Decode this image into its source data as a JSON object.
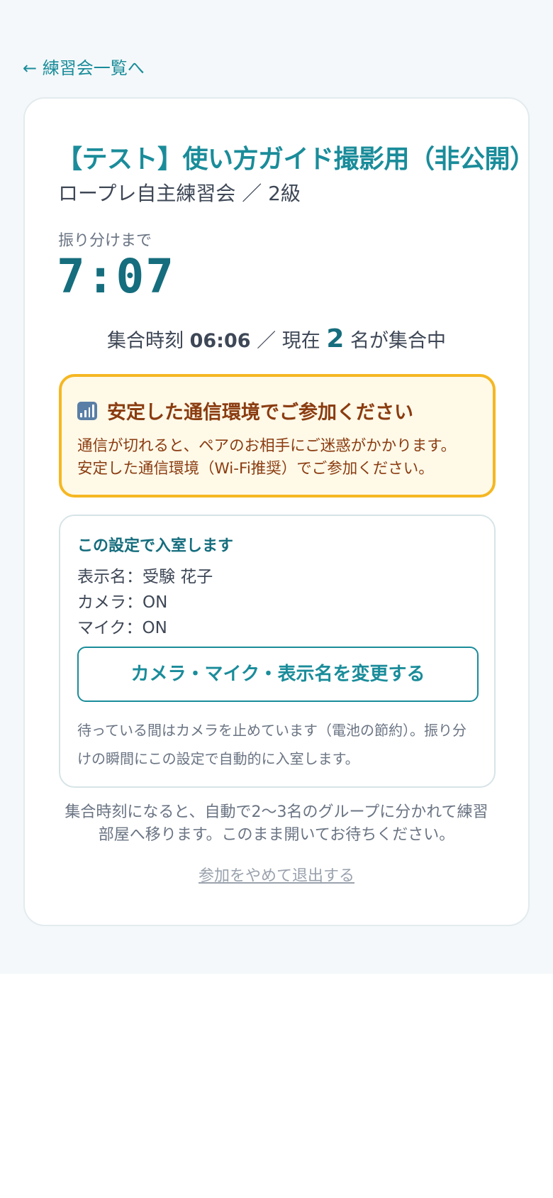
{
  "nav": {
    "back_label": "← 練習会一覧へ"
  },
  "event": {
    "title": "【テスト】使い方ガイド撮影用（非公開）",
    "subtitle": "ロープレ自主練習会 ／ 2級"
  },
  "countdown": {
    "label": "振り分けまで",
    "value": "7:07"
  },
  "gathering": {
    "prefix": "集合時刻 ",
    "time": "06:06",
    "middle": " ／ 現在 ",
    "count": "2",
    "suffix": " 名が集合中"
  },
  "warning": {
    "icon": "signal-strength-icon",
    "title": "安定した通信環境でご参加ください",
    "line1": "通信が切れると、ペアのお相手にご迷惑がかかります。",
    "line2": "安定した通信環境（Wi-Fi推奨）でご参加ください。"
  },
  "settings": {
    "title": "この設定で入室します",
    "display_name": "表示名：受験 花子",
    "camera": "カメラ：ON",
    "mic": "マイク：ON",
    "change_button": "カメラ・マイク・表示名を変更する",
    "note": "待っている間はカメラを止めています（電池の節約）。振り分けの瞬間にこの設定で自動的に入室します。"
  },
  "footer": {
    "note": "集合時刻になると、自動で2〜3名のグループに分かれて練習部屋へ移ります。このまま開いてお待ちください。",
    "leave_link": "参加をやめて退出する"
  },
  "colors": {
    "accent": "#1a8c9a",
    "countdown": "#156d7d",
    "warning_border": "#f5b722",
    "warning_bg": "#fff9e8",
    "warning_text": "#8a3c10",
    "page_bg": "#f4f8fa"
  }
}
